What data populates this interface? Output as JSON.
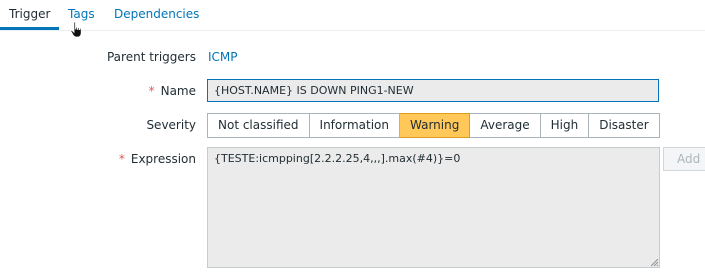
{
  "tabs": [
    {
      "label": "Trigger",
      "active": true
    },
    {
      "label": "Tags",
      "active": false
    },
    {
      "label": "Dependencies",
      "active": false
    }
  ],
  "form": {
    "parent_triggers": {
      "label": "Parent triggers",
      "value": "ICMP"
    },
    "name": {
      "label": "Name",
      "required_mark": "*",
      "value": "{HOST.NAME} IS DOWN PING1-NEW"
    },
    "severity": {
      "label": "Severity",
      "options": [
        "Not classified",
        "Information",
        "Warning",
        "Average",
        "High",
        "Disaster"
      ],
      "selected": "Warning",
      "selected_color": "#ffc859"
    },
    "expression": {
      "label": "Expression",
      "required_mark": "*",
      "value": "{TESTE:icmpping[2.2.2.25,4,,,].max(#4)}=0",
      "add_label": "Add"
    }
  },
  "colors": {
    "accent": "#0275b8",
    "required": "#e45959",
    "warning": "#ffc859"
  },
  "icons": [
    "hand-pointer-cursor-icon",
    "resize-grip-icon"
  ]
}
